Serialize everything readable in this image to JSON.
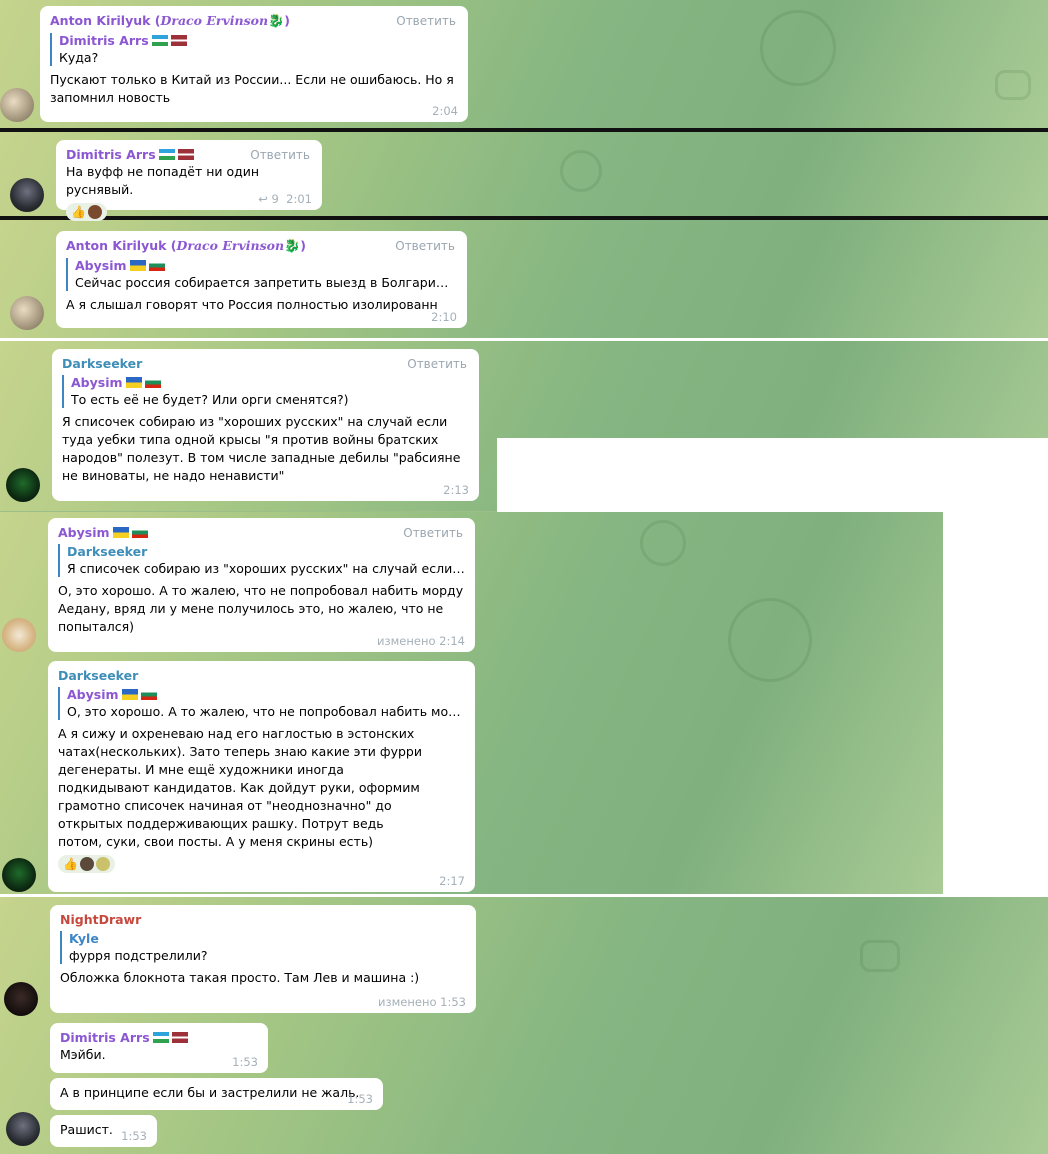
{
  "reply_label": "Ответить",
  "colors": {
    "purple": "#8b57d2",
    "blue": "#3d86c6",
    "red": "#c6483d",
    "teal": "#3e8eb8"
  },
  "m1": {
    "name": "Anton Kirilyuk",
    "name_alias": "Draco Ervinson",
    "quote_name": "Dimitris Arrs",
    "quote_text": "Куда?",
    "text": "Пускают только в Китай из России... Если не ошибаюсь. Но я запомнил новость",
    "time": "2:04"
  },
  "m2": {
    "name": "Dimitris Arrs",
    "text": "На вуфф не попадёт ни один руснявый.",
    "forwards": "9",
    "time": "2:01"
  },
  "m3": {
    "name": "Anton Kirilyuk",
    "name_alias": "Draco Ervinson",
    "quote_name": "Abysim",
    "quote_text": "Сейчас россия собирается запретить выезд в Болгарию, п...",
    "text": "А я слышал говорят что Россия полностью изолированн",
    "time": "2:10"
  },
  "m4": {
    "name": "Darkseeker",
    "quote_name": "Abysim",
    "quote_text": "То есть её не будет? Или орги сменятся?)",
    "text": "Я списочек собираю из \"хороших русских\" на случай если туда уебки типа одной крысы \"я против войны братских народов\" полезут. В том числе западные дебилы \"рабсияне не виноваты, не надо ненависти\"",
    "time": "2:13"
  },
  "m5": {
    "name": "Abysim",
    "quote_name": "Darkseeker",
    "quote_text": "Я списочек собираю из \"хороших русских\" на случай если ту...",
    "text": "О, это хорошо. А то жалею, что не попробовал набить морду Аедану, вряд ли у мене получилось это, но жалею, что не попытался)",
    "time": "изменено 2:14"
  },
  "m6": {
    "name": "Darkseeker",
    "quote_name": "Abysim",
    "quote_text": "О, это хорошо. А то жалею, что не попробовал набить морду...",
    "text": "А я сижу и охреневаю над его наглостью в эстонских чатах(нескольких). Зато теперь знаю какие эти фурри дегенераты. И мне ещё художники иногда подкидывают кандидатов. Как дойдут руки, оформим грамотно списочек начиная от \"неоднозначно\" до открытых поддерживающих рашку. Потрут ведь потом, суки, свои посты. А у меня скрины есть)",
    "time": "2:17"
  },
  "m7": {
    "name": "NightDrawr",
    "quote_name": "Kyle",
    "quote_text": "фурря подстрелили?",
    "text": "Обложка блокнота такая просто. Там Лев и машина :)",
    "time": "изменено 1:53"
  },
  "m8": {
    "name": "Dimitris Arrs",
    "text": "Мэйби.",
    "time": "1:53"
  },
  "m9": {
    "text": "А в принципе если бы и застрелили не жаль.",
    "time": "1:53"
  },
  "m10": {
    "text": "Рашист.",
    "time": "1:53"
  },
  "reactions": {
    "thumbs": "👍"
  }
}
